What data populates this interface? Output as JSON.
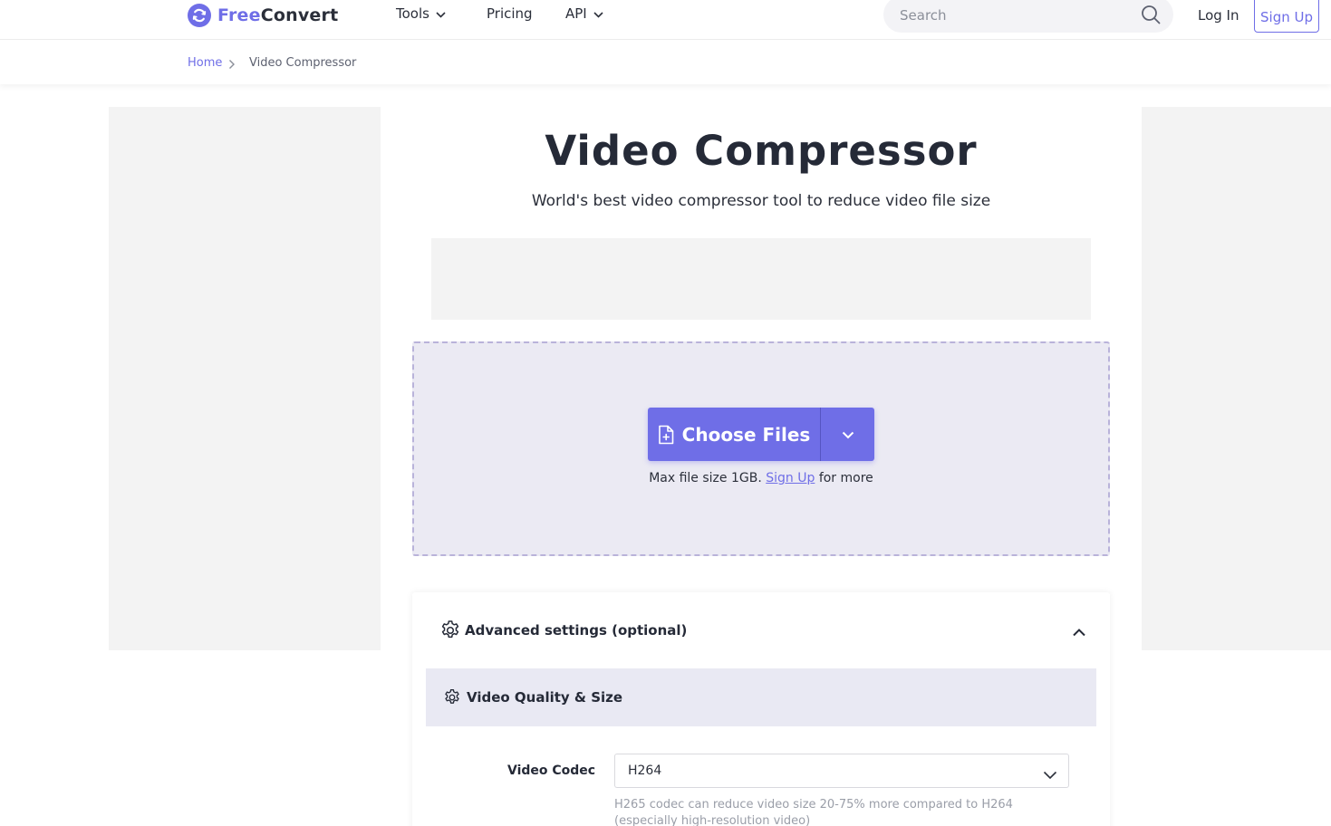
{
  "header": {
    "logo_free": "Free",
    "logo_convert": "Convert",
    "nav": [
      {
        "label": "Tools",
        "has_dropdown": true
      },
      {
        "label": "Pricing",
        "has_dropdown": false
      },
      {
        "label": "API",
        "has_dropdown": true
      }
    ],
    "search_placeholder": "Search",
    "login_label": "Log In",
    "signup_label": "Sign Up"
  },
  "breadcrumb": {
    "home": "Home",
    "current": "Video Compressor"
  },
  "main": {
    "title": "Video Compressor",
    "subtitle": "World's best video compressor tool to reduce video file size",
    "upload": {
      "button_label": "Choose Files",
      "note_prefix": "Max file size 1GB.",
      "note_link": "Sign Up",
      "note_suffix": "for more"
    },
    "advanced": {
      "title": "Advanced settings (optional)",
      "section_title": "Video Quality & Size",
      "codec_label": "Video Codec",
      "codec_value": "H264",
      "codec_hint": "H265 codec can reduce video size 20-75% more compared to H264 (especially high-resolution video)"
    }
  },
  "colors": {
    "accent": "#6f6ee7",
    "text": "#2b2f3a",
    "dropzone_bg": "#ebeaf3",
    "dropzone_border": "#b9b3da",
    "ad_bg": "#f3f3f3"
  }
}
